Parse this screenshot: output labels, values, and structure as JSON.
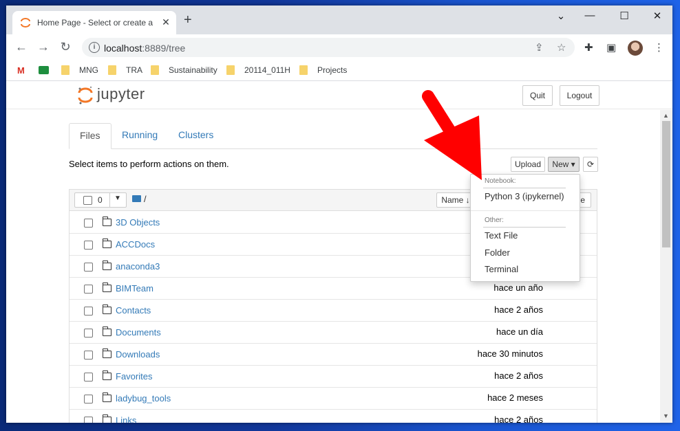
{
  "browser": {
    "tab_title": "Home Page - Select or create a notebook",
    "new_tab": "+",
    "close_tab": "✕",
    "url_host": "localhost",
    "url_rest": ":8889/tree",
    "window_controls": [
      "⌄",
      "—",
      "☐",
      "✕"
    ]
  },
  "bookmarks": [
    "MNG",
    "TRA",
    "Sustainability",
    "20114_011H",
    "Projects"
  ],
  "jupyter": {
    "logo_text": "jupyter",
    "quit": "Quit",
    "logout": "Logout",
    "tabs": [
      "Files",
      "Running",
      "Clusters"
    ],
    "instructions": "Select items to perform actions on them.",
    "upload": "Upload",
    "new": "New ▾",
    "refresh_icon": "⟳",
    "select_count": "0",
    "path": "/",
    "name_sort": "Name ↓",
    "hidden_button_fragment": "ze"
  },
  "new_menu": {
    "notebook_header": "Notebook:",
    "python": "Python 3 (ipykernel)",
    "other_header": "Other:",
    "text_file": "Text File",
    "folder": "Folder",
    "terminal": "Terminal"
  },
  "files": [
    {
      "name": "3D Objects",
      "modified": ""
    },
    {
      "name": "ACCDocs",
      "modified": ""
    },
    {
      "name": "anaconda3",
      "modified": ""
    },
    {
      "name": "BIMTeam",
      "modified": "hace un año"
    },
    {
      "name": "Contacts",
      "modified": "hace 2 años"
    },
    {
      "name": "Documents",
      "modified": "hace un día"
    },
    {
      "name": "Downloads",
      "modified": "hace 30 minutos"
    },
    {
      "name": "Favorites",
      "modified": "hace 2 años"
    },
    {
      "name": "ladybug_tools",
      "modified": "hace 2 meses"
    },
    {
      "name": "Links",
      "modified": "hace 2 años"
    }
  ],
  "colors": {
    "link": "#337ab7",
    "arrow": "#ff0000",
    "jupyter_orange": "#f37726"
  }
}
